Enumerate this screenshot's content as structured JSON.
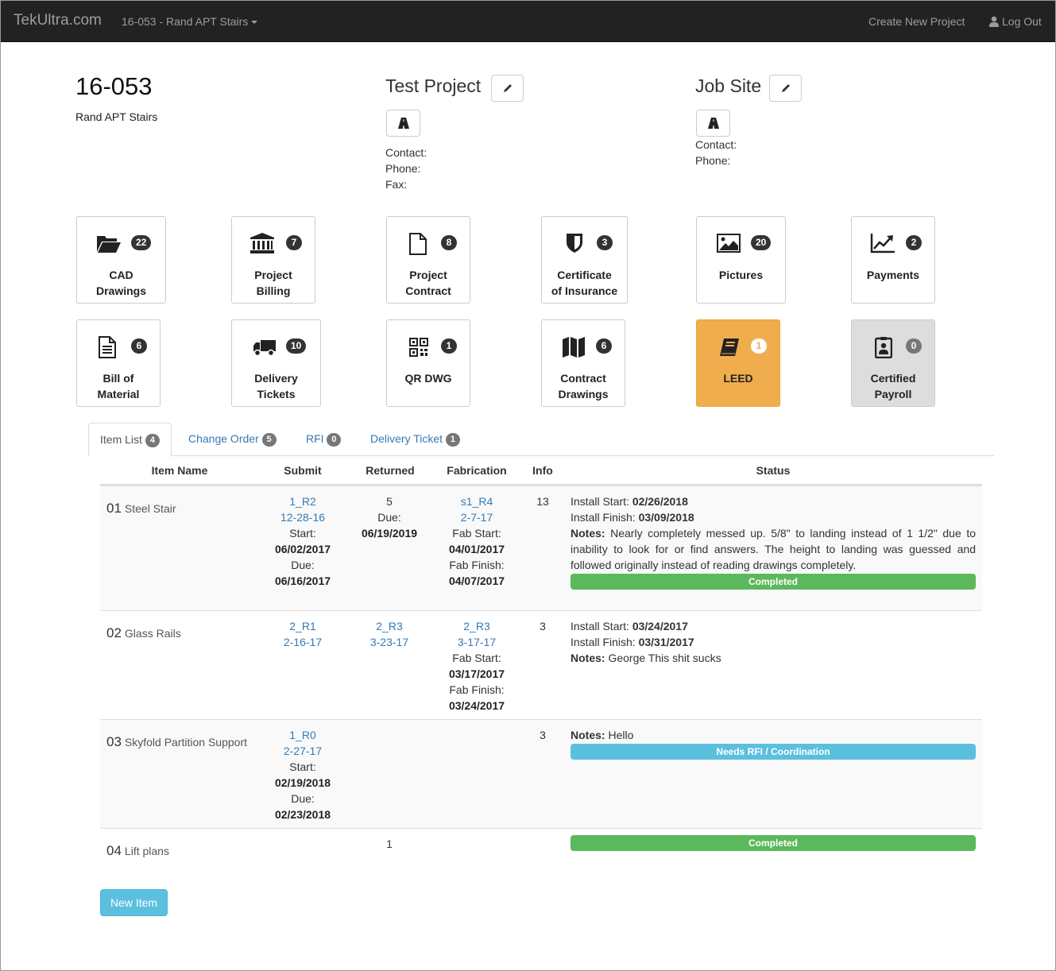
{
  "nav": {
    "brand": "TekUltra.com",
    "project_select": "16-053 - Rand APT Stairs",
    "create_project": "Create New Project",
    "logout": "Log Out"
  },
  "job": {
    "number": "16-053",
    "name": "Rand APT Stairs"
  },
  "test_project": {
    "title": "Test Project",
    "contact": "Contact:",
    "phone": "Phone:",
    "fax": "Fax:"
  },
  "job_site": {
    "title": "Job Site",
    "contact": "Contact:",
    "phone": "Phone:"
  },
  "tiles": [
    {
      "line1": "CAD",
      "line2": "Drawings",
      "count": "22",
      "icon": "folder-open-icon"
    },
    {
      "line1": "Project",
      "line2": "Billing",
      "count": "7",
      "icon": "bank-icon"
    },
    {
      "line1": "Project",
      "line2": "Contract",
      "count": "8",
      "icon": "file-icon"
    },
    {
      "line1": "Certificate",
      "line2": "of Insurance",
      "count": "3",
      "icon": "shield-icon"
    },
    {
      "line1": "Pictures",
      "line2": "",
      "count": "20",
      "icon": "picture-icon"
    },
    {
      "line1": "Payments",
      "line2": "",
      "count": "2",
      "icon": "trend-up-icon"
    },
    {
      "line1": "Bill of",
      "line2": "Material",
      "count": "6",
      "icon": "document-icon"
    },
    {
      "line1": "Delivery",
      "line2": "Tickets",
      "count": "10",
      "icon": "truck-icon"
    },
    {
      "line1": "QR DWG",
      "line2": "",
      "count": "1",
      "icon": "qrcode-icon"
    },
    {
      "line1": "Contract",
      "line2": "Drawings",
      "count": "6",
      "icon": "map-icon"
    },
    {
      "line1": "LEED",
      "line2": "",
      "count": "1",
      "icon": "book-icon",
      "color": "#f0ad4e"
    },
    {
      "line1": "Certified",
      "line2": "Payroll",
      "count": "0",
      "icon": "id-badge-icon",
      "color": "#dddddd"
    }
  ],
  "tabs": [
    {
      "label": "Item List",
      "count": "4"
    },
    {
      "label": "Change Order",
      "count": "5"
    },
    {
      "label": "RFI",
      "count": "0"
    },
    {
      "label": "Delivery Ticket",
      "count": "1"
    }
  ],
  "table": {
    "headers": [
      "Item Name",
      "Submit",
      "Returned",
      "Fabrication",
      "Info",
      "Status"
    ],
    "rows": [
      {
        "num": "01",
        "name": "Steel Stair",
        "submit": {
          "link1": "1_R2",
          "link2": "12-28-16",
          "start_label": "Start:",
          "start": "06/02/2017",
          "due_label": "Due:",
          "due": "06/16/2017"
        },
        "returned": {
          "value": "5",
          "due_label": "Due:",
          "due": "06/19/2019"
        },
        "fab": {
          "link1": "s1_R4",
          "link2": "2-7-17",
          "start_label": "Fab Start:",
          "start": "04/01/2017",
          "finish_label": "Fab Finish:",
          "finish": "04/07/2017"
        },
        "info": "13",
        "status": {
          "install_start_label": "Install Start:",
          "install_start": "02/26/2018",
          "install_finish_label": "Install Finish:",
          "install_finish": "03/09/2018",
          "notes_label": "Notes:",
          "notes": "Nearly completely messed up. 5/8\" to landing instead of 1 1/2\" due to inability to look for or find answers. The height to landing was guessed and followed originally instead of reading drawings completely.",
          "bar": "Completed",
          "bar_color": "#5cb85c"
        }
      },
      {
        "num": "02",
        "name": "Glass Rails",
        "submit": {
          "link1": "2_R1",
          "link2": "2-16-17"
        },
        "returned": {
          "link1": "2_R3",
          "link2": "3-23-17"
        },
        "fab": {
          "link1": "2_R3",
          "link2": "3-17-17",
          "start_label": "Fab Start:",
          "start": "03/17/2017",
          "finish_label": "Fab Finish:",
          "finish": "03/24/2017"
        },
        "info": "3",
        "status": {
          "install_start_label": "Install Start:",
          "install_start": "03/24/2017",
          "install_finish_label": "Install Finish:",
          "install_finish": "03/31/2017",
          "notes_label": "Notes:",
          "notes": "George This shit sucks"
        }
      },
      {
        "num": "03",
        "name": "Skyfold Partition Support",
        "submit": {
          "link1": "1_R0",
          "link2": "2-27-17",
          "start_label": "Start:",
          "start": "02/19/2018",
          "due_label": "Due:",
          "due": "02/23/2018"
        },
        "info": "3",
        "status": {
          "notes_label": "Notes:",
          "notes": "Hello",
          "bar": "Needs RFI / Coordination",
          "bar_color": "#5bc0de"
        }
      },
      {
        "num": "04",
        "name": "Lift plans",
        "returned": {
          "value": "1"
        },
        "status": {
          "bar": "Completed",
          "bar_color": "#5cb85c"
        }
      }
    ]
  },
  "new_item_button": "New Item"
}
